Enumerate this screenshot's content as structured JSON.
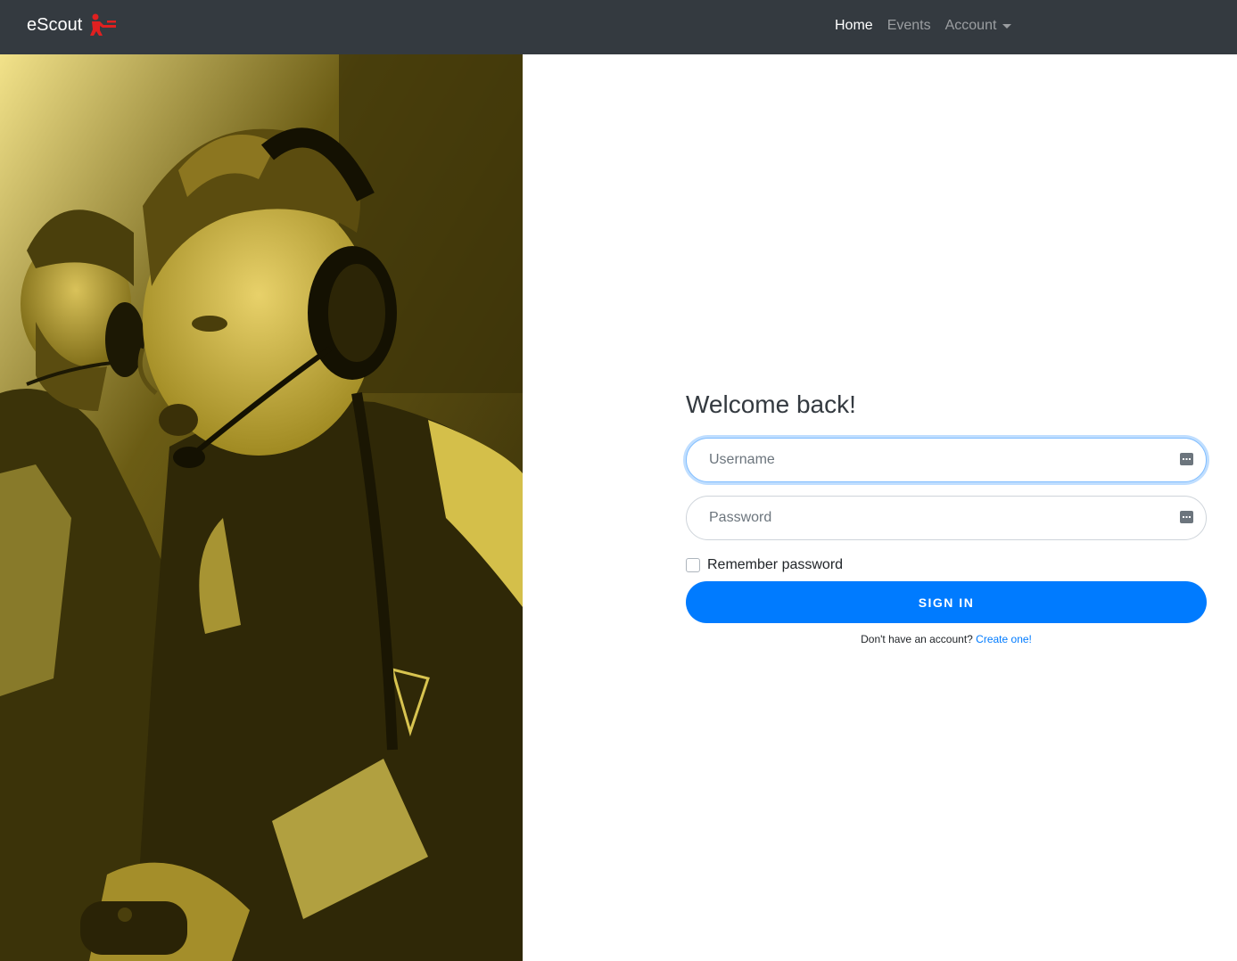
{
  "navbar": {
    "brand": "eScout",
    "brand_logo": "red-figure-logo-icon",
    "links": [
      {
        "label": "Home",
        "active": true
      },
      {
        "label": "Events",
        "active": false
      }
    ],
    "account_label": "Account"
  },
  "hero": {
    "image": "esports-players-photo",
    "tint": "#d8c23a"
  },
  "login": {
    "title": "Welcome back!",
    "username_placeholder": "Username",
    "password_placeholder": "Password",
    "remember_label": "Remember password",
    "signin_label": "Sign in",
    "signup_prompt": "Don't have an account?",
    "signup_link": "Create one!"
  },
  "colors": {
    "navbar_bg": "#343a40",
    "primary": "#007bff",
    "brand_red": "#e02020"
  }
}
